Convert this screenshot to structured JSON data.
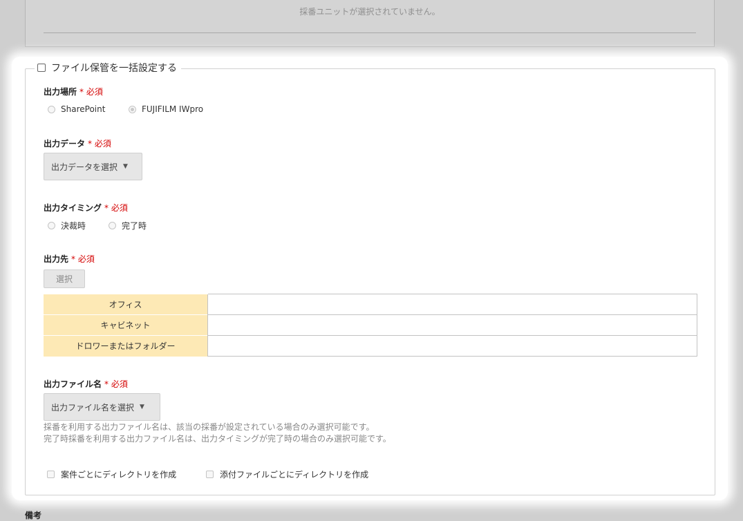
{
  "top": {
    "message": "採番ユニットが選択されていません。"
  },
  "bulk": {
    "legend_label": "ファイル保管を一括設定する"
  },
  "required_mark": "*",
  "required_text": "必須",
  "output_location": {
    "label": "出力場所",
    "options": [
      "SharePoint",
      "FUJIFILM IWpro"
    ],
    "selected": "FUJIFILM IWpro"
  },
  "output_data": {
    "label": "出力データ",
    "select_value": "出力データを選択"
  },
  "output_timing": {
    "label": "出力タイミング",
    "options": [
      "決裁時",
      "完了時"
    ]
  },
  "destination": {
    "label": "出力先",
    "button_label": "選択",
    "rows": [
      {
        "header": "オフィス",
        "value": ""
      },
      {
        "header": "キャビネット",
        "value": ""
      },
      {
        "header": "ドロワーまたはフォルダー",
        "value": ""
      }
    ]
  },
  "output_filename": {
    "label": "出力ファイル名",
    "select_value": "出力ファイル名を選択",
    "help_lines": [
      "採番を利用する出力ファイル名は、該当の採番が設定されている場合のみ選択可能です。",
      "完了時採番を利用する出力ファイル名は、出力タイミングが完了時の場合のみ選択可能です。"
    ]
  },
  "directories": {
    "per_case_label": "案件ごとにディレクトリを作成",
    "per_attachment_label": "添付ファイルごとにディレクトリを作成"
  },
  "notes": {
    "label": "備考"
  },
  "colors": {
    "required": "#d40000",
    "table_header": "#fde9b5"
  }
}
